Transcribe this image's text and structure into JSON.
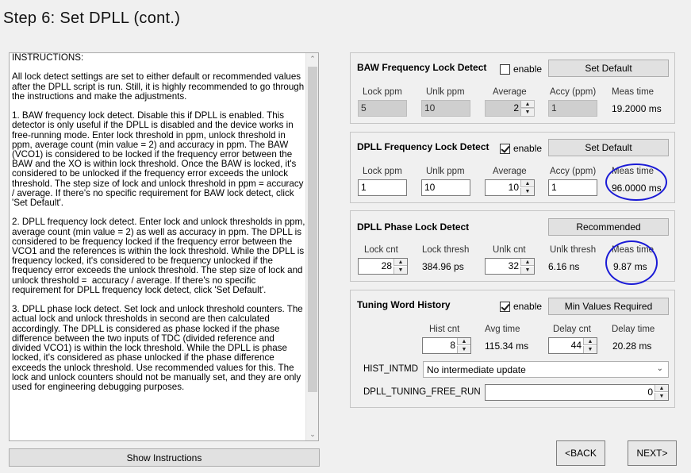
{
  "header": {
    "title": "Step 6: Set DPLL (cont.)"
  },
  "instructions": {
    "text": "INSTRUCTIONS:\n\nAll lock detect settings are set to either default or recommended values after the DPLL script is run. Still, it is highly recommended to go through the instructions and make the adjustments.\n\n1. BAW frequency lock detect. Disable this if DPLL is enabled. This detector is only useful if the DPLL is disabled and the device works in free-running mode. Enter lock threshold in ppm, unlock threshold in ppm, average count (min value = 2) and accuracy in ppm. The BAW (VCO1) is considered to be locked if the frequency error between the BAW and the XO is within lock threshold. Once the BAW is locked, it's considered to be unlocked if the frequency error exceeds the unlock threshold. The step size of lock and unlock threshold in ppm = accuracy / average. If there's no specific requirement for BAW lock detect, click 'Set Default'.\n\n2. DPLL frequency lock detect. Enter lock and unlock thresholds in ppm, average count (min value = 2) as well as accuracy in ppm. The DPLL is considered to be frequency locked if the frequency error between the VCO1 and the references is within the lock threshold. While the DPLL is frequency locked, it's considered to be frequency unlocked if the frequency error exceeds the unlock threshold. The step size of lock and unlock threshold =  accuracy / average. If there's no specific requirement for DPLL frequency lock detect, click 'Set Default'.\n\n3. DPLL phase lock detect. Set lock and unlock threshold counters. The actual lock and unlock thresholds in second are then calculated accordingly. The DPLL is considered as phase locked if the phase difference between the two inputs of TDC (divided reference and divided VCO1) is within the lock threshold. While the DPLL is phase locked, it's considered as phase unlocked if the phase difference exceeds the unlock threshold. Use recommended values for this. The lock and unlock counters should not be manually set, and they are only used for engineering debugging purposes.",
    "show_button": "Show Instructions"
  },
  "baw": {
    "title": "BAW Frequency Lock Detect",
    "enable_label": "enable",
    "enabled": false,
    "button": "Set Default",
    "headers": [
      "Lock ppm",
      "Unlk ppm",
      "Average",
      "Accy (ppm)",
      "Meas time"
    ],
    "lock_ppm": "5",
    "unlk_ppm": "10",
    "average": "2",
    "accy": "1",
    "meas_time": "19.2000 ms"
  },
  "dpll_freq": {
    "title": "DPLL Frequency Lock Detect",
    "enable_label": "enable",
    "enabled": true,
    "button": "Set Default",
    "headers": [
      "Lock ppm",
      "Unlk ppm",
      "Average",
      "Accy (ppm)",
      "Meas time"
    ],
    "lock_ppm": "1",
    "unlk_ppm": "10",
    "average": "10",
    "accy": "1",
    "meas_time": "96.0000 ms"
  },
  "dpll_phase": {
    "title": "DPLL Phase Lock Detect",
    "button": "Recommended",
    "headers": [
      "Lock cnt",
      "Lock thresh",
      "Unlk cnt",
      "Unlk thresh",
      "Meas time"
    ],
    "lock_cnt": "28",
    "lock_thresh": "384.96 ps",
    "unlk_cnt": "32",
    "unlk_thresh": "6.16 ns",
    "meas_time": "9.87 ms"
  },
  "tuning": {
    "title": "Tuning Word History",
    "enable_label": "enable",
    "enabled": true,
    "button": "Min Values Required",
    "headers": [
      "Hist cnt",
      "Avg time",
      "Delay cnt",
      "Delay time"
    ],
    "hist_cnt": "8",
    "avg_time": "115.34 ms",
    "delay_cnt": "44",
    "delay_time": "20.28 ms",
    "hist_intmd_label": "HIST_INTMD",
    "hist_intmd_value": "No intermediate update",
    "free_run_label": "DPLL_TUNING_FREE_RUN",
    "free_run_value": "0"
  },
  "nav": {
    "back": "<BACK",
    "next": "NEXT>"
  },
  "colors": {
    "annotation": "#1a1ad6",
    "disabled_field": "#cfcfcf"
  }
}
